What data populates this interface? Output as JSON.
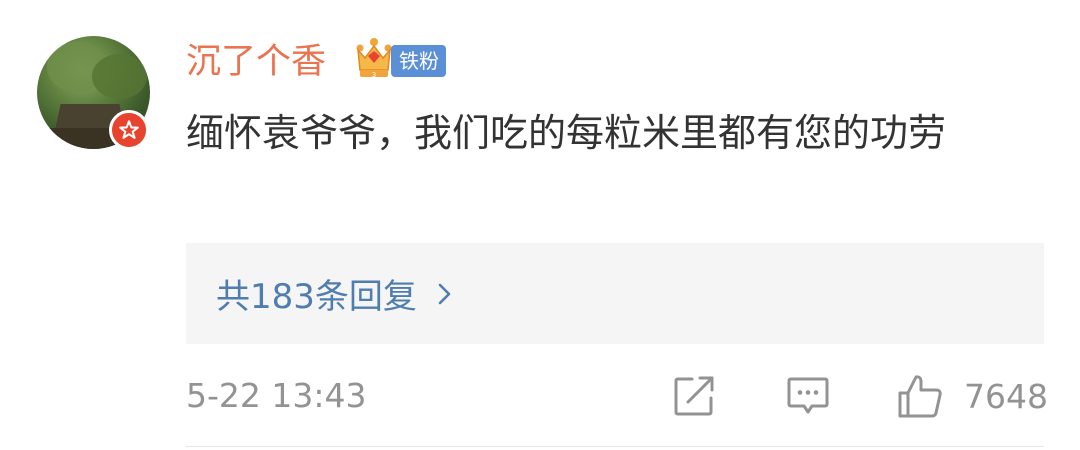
{
  "comment": {
    "author": {
      "name": "沉了个香",
      "fan_badge": "铁粉",
      "crown_level": "3"
    },
    "text": "缅怀袁爷爷，我们吃的每粒米里都有您的功劳",
    "replies": {
      "label": "共183条回复"
    },
    "timestamp": "5-22 13:43",
    "likes": "7648"
  },
  "colors": {
    "name": "#eb7350",
    "link": "#507daf",
    "meta": "#939393",
    "fan_badge_bg": "#5b8fd6",
    "verified_badge_bg": "#e8432f"
  },
  "icons": [
    "share-icon",
    "comment-icon",
    "like-icon",
    "chevron-right-icon",
    "crown-icon",
    "verified-badge-icon"
  ]
}
